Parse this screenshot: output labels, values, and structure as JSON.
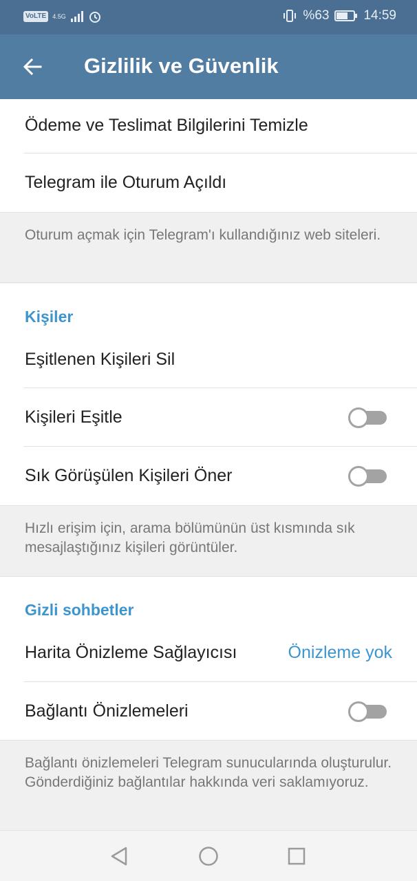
{
  "status_bar": {
    "volte": "VoLTE",
    "network": "4.5G",
    "battery_percent": "%63",
    "time": "14:59",
    "icons": [
      "signal-icon",
      "alarm-icon",
      "vibrate-icon",
      "battery-icon"
    ]
  },
  "header": {
    "title": "Gizlilik ve Güvenlik",
    "back_icon": "arrow-left-icon"
  },
  "sections": {
    "top": {
      "items": [
        {
          "label": "Ödeme ve Teslimat Bilgilerini Temizle"
        },
        {
          "label": "Telegram ile Oturum Açıldı"
        }
      ],
      "hint": "Oturum açmak için Telegram'ı kullandığınız web siteleri."
    },
    "contacts": {
      "title": "Kişiler",
      "items": [
        {
          "label": "Eşitlenen Kişileri Sil"
        },
        {
          "label": "Kişileri Eşitle",
          "toggle": false
        },
        {
          "label": "Sık Görüşülen Kişileri Öner",
          "toggle": false
        }
      ],
      "hint": "Hızlı erişim için, arama bölümünün üst kısmında sık mesajlaştığınız kişileri görüntüler."
    },
    "secret_chats": {
      "title": "Gizli sohbetler",
      "items": [
        {
          "label": "Harita Önizleme Sağlayıcısı",
          "value": "Önizleme yok"
        },
        {
          "label": "Bağlantı Önizlemeleri",
          "toggle": false
        }
      ],
      "hint": "Bağlantı önizlemeleri Telegram sunucularında oluşturulur. Gönderdiğiniz bağlantılar hakkında veri saklamıyoruz."
    }
  },
  "nav": {
    "back": "nav-back-icon",
    "home": "nav-home-icon",
    "recents": "nav-recents-icon"
  },
  "colors": {
    "status_bar": "#4a6f92",
    "app_bar": "#527da3",
    "accent": "#3d95ce",
    "toggle_off": "#a3a3a3"
  }
}
